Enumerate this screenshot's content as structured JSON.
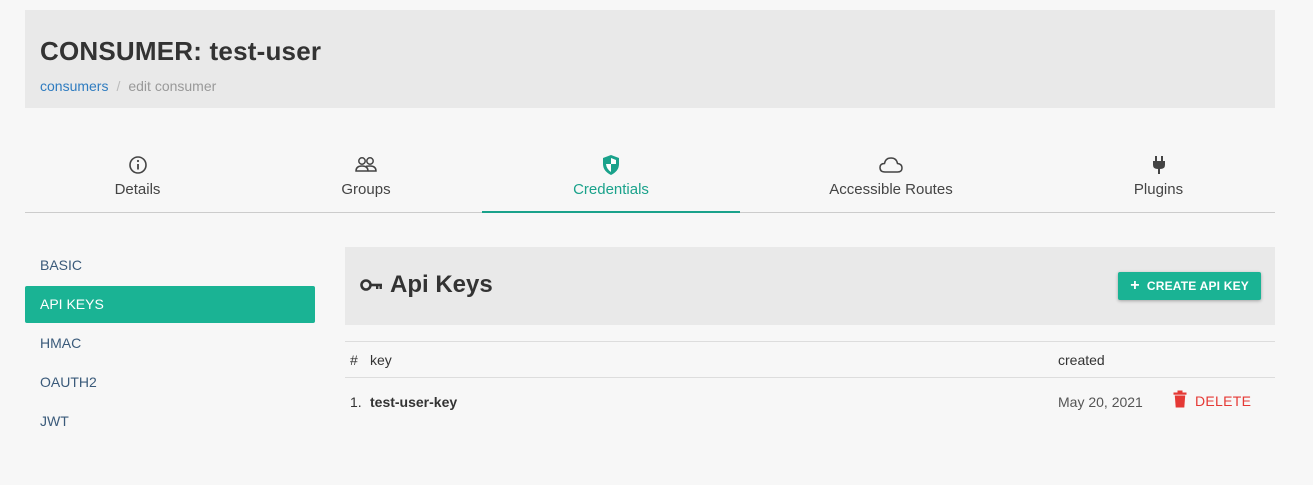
{
  "header": {
    "title": "CONSUMER: test-user",
    "breadcrumb": {
      "link": "consumers",
      "separator": "/",
      "current": "edit consumer"
    }
  },
  "tabs": [
    {
      "label": "Details",
      "icon": "info-icon"
    },
    {
      "label": "Groups",
      "icon": "users-icon"
    },
    {
      "label": "Credentials",
      "icon": "shield-icon",
      "active": true
    },
    {
      "label": "Accessible Routes",
      "icon": "cloud-icon"
    },
    {
      "label": "Plugins",
      "icon": "plug-icon"
    }
  ],
  "sidebar": {
    "items": [
      {
        "label": "BASIC"
      },
      {
        "label": "API KEYS",
        "active": true
      },
      {
        "label": "HMAC"
      },
      {
        "label": "OAUTH2"
      },
      {
        "label": "JWT"
      }
    ]
  },
  "panel": {
    "title": "Api Keys",
    "icon": "key-icon",
    "create_button": "CREATE API KEY"
  },
  "table": {
    "headers": {
      "num": "#",
      "key": "key",
      "created": "created"
    },
    "rows": [
      {
        "num": "1.",
        "key": "test-user-key",
        "created": "May 20, 2021",
        "action": "DELETE"
      }
    ]
  },
  "colors": {
    "accent": "#1ab394",
    "danger": "#e53935",
    "link": "#2f7cc0"
  }
}
